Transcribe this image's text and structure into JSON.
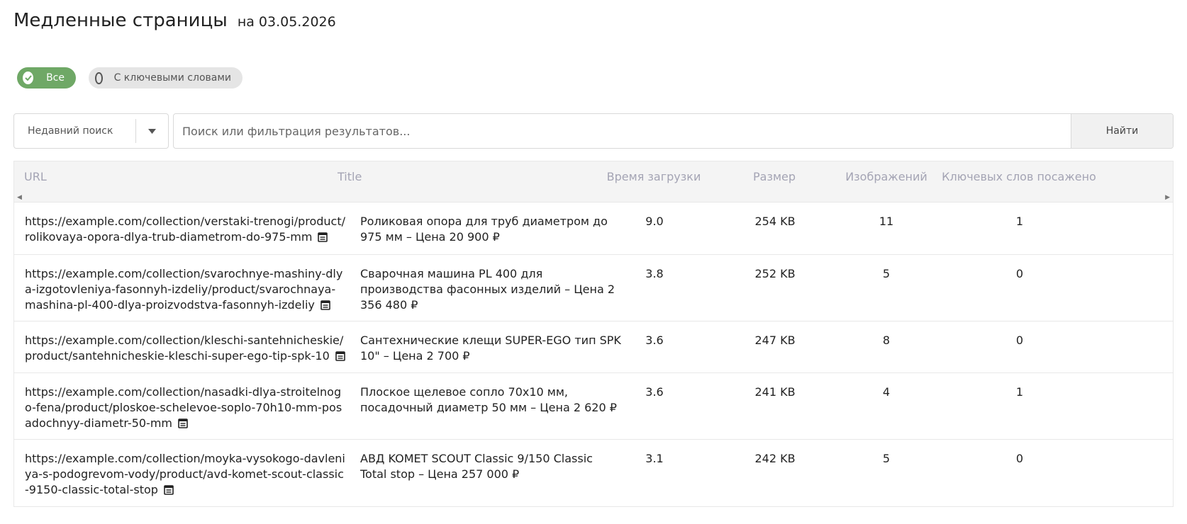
{
  "header": {
    "title": "Медленные страницы",
    "date": "на 03.05.2026"
  },
  "filters": [
    {
      "label": "Все",
      "active": true
    },
    {
      "label": "С ключевыми словами",
      "active": false
    }
  ],
  "search": {
    "recent_label": "Недавний поиск",
    "placeholder": "Поиск или фильтрация результатов...",
    "value": "",
    "button_label": "Найти"
  },
  "table": {
    "columns": [
      "URL",
      "Title",
      "Время загрузки",
      "Размер",
      "Изображений",
      "Ключевых слов посажено"
    ],
    "rows": [
      {
        "url": "https://example.com/collection/verstaki-trenogi/product/rolikovaya-opora-dlya-trub-diametrom-do-975-mm",
        "title": "Роликовая опора для труб диаметром до 975 мм – Цена 20 900 ₽",
        "time": "9.0",
        "size": "254 KB",
        "images": "11",
        "keywords": "1"
      },
      {
        "url": "https://example.com/collection/svarochnye-mashiny-dlya-izgotovleniya-fasonnyh-izdeliy/product/svarochnaya-mashina-pl-400-dlya-proizvodstva-fasonnyh-izdeliy",
        "title": "Сварочная машина PL 400 для производства фасонных изделий – Цена 2 356 480 ₽",
        "time": "3.8",
        "size": "252 KB",
        "images": "5",
        "keywords": "0"
      },
      {
        "url": "https://example.com/collection/kleschi-santehnicheskie/product/santehnicheskie-kleschi-super-ego-tip-spk-10",
        "title": "Сантехнические клещи SUPER-EGO тип SPK 10\" – Цена 2 700 ₽",
        "time": "3.6",
        "size": "247 KB",
        "images": "8",
        "keywords": "0"
      },
      {
        "url": "https://example.com/collection/nasadki-dlya-stroitelnogo-fena/product/ploskoe-schelevoe-soplo-70h10-mm-posadochnyy-diametr-50-mm",
        "title": "Плоское щелевое сопло 70x10 мм, посадочный диаметр 50 мм – Цена 2 620 ₽",
        "time": "3.6",
        "size": "241 KB",
        "images": "4",
        "keywords": "1"
      },
      {
        "url": "https://example.com/collection/moyka-vysokogo-davleniya-s-podogrevom-vody/product/avd-komet-scout-classic-9150-classic-total-stop",
        "title": "АВД KOMET SCOUT Classic 9/150 Classic Total stop – Цена 257 000 ₽",
        "time": "3.1",
        "size": "242 KB",
        "images": "5",
        "keywords": "0"
      }
    ]
  },
  "colors": {
    "accent": "#6fa866",
    "header_text": "#a4a4b4",
    "border": "#e8e8e8"
  },
  "icons": {
    "filter_active": "check-icon",
    "filter_inactive": "radio-icon",
    "dropdown": "caret-down-icon",
    "row_action": "calendar-icon"
  }
}
